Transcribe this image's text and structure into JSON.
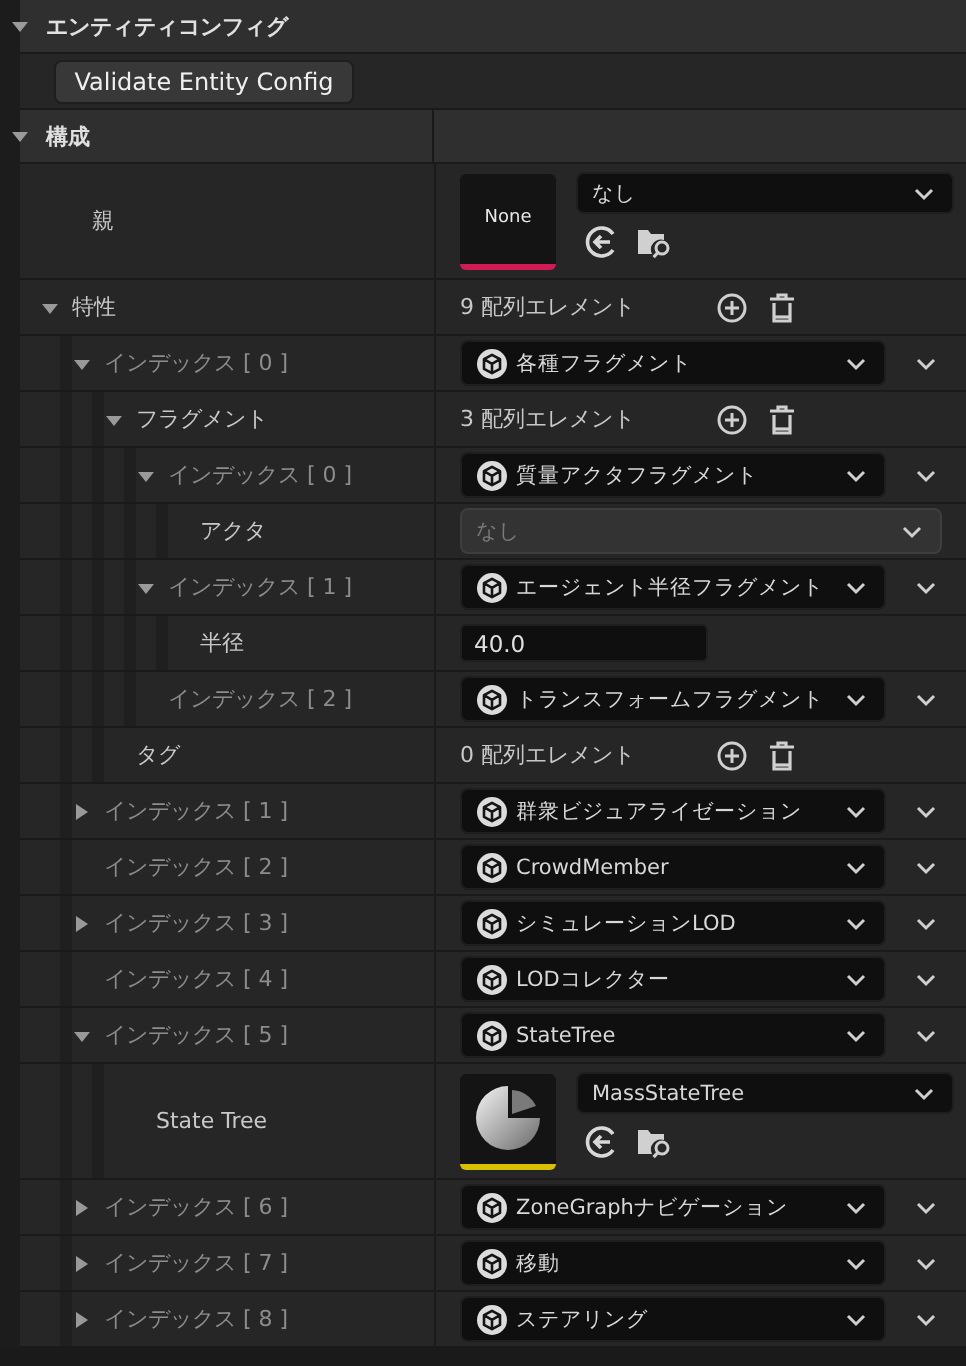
{
  "categories": [
    {
      "title": "エンティティコンフィグ",
      "expanded": true,
      "button": "Validate Entity Config"
    },
    {
      "title": "構成",
      "expanded": true,
      "properties": [
        {
          "name": "親",
          "value": {
            "kind": "asset",
            "thumbnail": {
              "kind": "empty",
              "text": "None",
              "color": "#d21b55"
            },
            "selection": "なし"
          }
        },
        {
          "name": "特性",
          "expanded": true,
          "value": {
            "kind": "array",
            "count": "9 配列エレメント"
          },
          "children": [
            {
              "name": "インデックス [ 0 ]",
              "expanded": true,
              "value": {
                "kind": "struct",
                "text": "各種フラグメント"
              },
              "children": [
                {
                  "name": "フラグメント",
                  "expanded": true,
                  "value": {
                    "kind": "array",
                    "count": "3 配列エレメント"
                  },
                  "children": [
                    {
                      "name": "インデックス [ 0 ]",
                      "expanded": true,
                      "value": {
                        "kind": "struct",
                        "text": "質量アクタフラグメント"
                      },
                      "children": [
                        {
                          "name": "アクタ",
                          "value": {
                            "kind": "object",
                            "text": "なし",
                            "disabled": true
                          }
                        }
                      ]
                    },
                    {
                      "name": "インデックス [ 1 ]",
                      "expanded": true,
                      "value": {
                        "kind": "struct",
                        "text": "エージェント半径フラグメント"
                      },
                      "children": [
                        {
                          "name": "半径",
                          "value": {
                            "kind": "number",
                            "text": "40.0"
                          }
                        }
                      ]
                    },
                    {
                      "name": "インデックス [ 2 ]",
                      "value": {
                        "kind": "struct",
                        "text": "トランスフォームフラグメント"
                      }
                    }
                  ]
                },
                {
                  "name": "タグ",
                  "value": {
                    "kind": "array",
                    "count": "0 配列エレメント"
                  }
                }
              ]
            },
            {
              "name": "インデックス [ 1 ]",
              "expanded": false,
              "value": {
                "kind": "struct",
                "text": "群衆ビジュアライゼーション"
              }
            },
            {
              "name": "インデックス [ 2 ]",
              "value": {
                "kind": "struct",
                "text": "CrowdMember"
              }
            },
            {
              "name": "インデックス [ 3 ]",
              "expanded": false,
              "value": {
                "kind": "struct",
                "text": "シミュレーションLOD"
              }
            },
            {
              "name": "インデックス [ 4 ]",
              "value": {
                "kind": "struct",
                "text": "LODコレクター"
              }
            },
            {
              "name": "インデックス [ 5 ]",
              "expanded": true,
              "value": {
                "kind": "struct",
                "text": "StateTree"
              },
              "children": [
                {
                  "name": "State Tree",
                  "value": {
                    "kind": "asset",
                    "thumbnail": {
                      "kind": "state_tree",
                      "color": "#d8c000"
                    },
                    "selection": "MassStateTree"
                  }
                }
              ]
            },
            {
              "name": "インデックス [ 6 ]",
              "expanded": false,
              "value": {
                "kind": "struct",
                "text": "ZoneGraphナビゲーション"
              }
            },
            {
              "name": "インデックス [ 7 ]",
              "expanded": false,
              "value": {
                "kind": "struct",
                "text": "移動"
              }
            },
            {
              "name": "インデックス [ 8 ]",
              "expanded": false,
              "value": {
                "kind": "struct",
                "text": "ステアリング"
              }
            }
          ]
        }
      ]
    }
  ]
}
